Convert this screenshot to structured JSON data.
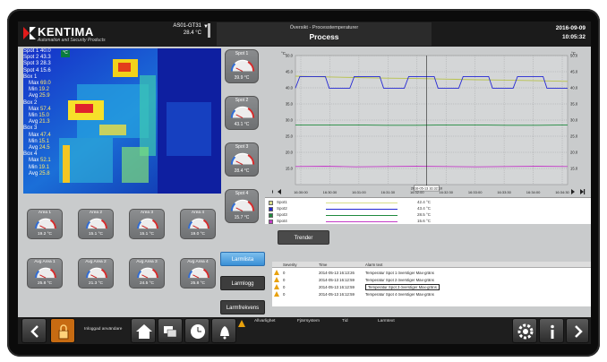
{
  "header": {
    "brand": "KENTIMA",
    "tagline": "Automation and Security Products",
    "sensor_id": "AS01-GT31",
    "sensor_value": "28.4 °C",
    "subtitle": "Översikt - Processtemperaturer",
    "title": "Process",
    "date": "2016-09-09",
    "time": "10:05:32"
  },
  "thermal": {
    "badge": "°C",
    "stats": [
      {
        "label": "Spot 1",
        "value": "40.0"
      },
      {
        "label": "Spot 2",
        "value": "43.3"
      },
      {
        "label": "Spot 3",
        "value": "28.3"
      },
      {
        "label": "Spot 4",
        "value": "15.6"
      },
      {
        "label": "Box 1",
        "value": ""
      },
      {
        "label": "Max",
        "value": "69.0"
      },
      {
        "label": "Min",
        "value": "19.2"
      },
      {
        "label": "Avg",
        "value": "25.9"
      },
      {
        "label": "Box 2",
        "value": ""
      },
      {
        "label": "Max",
        "value": "57.4"
      },
      {
        "label": "Min",
        "value": "15.0"
      },
      {
        "label": "Avg",
        "value": "21.3"
      },
      {
        "label": "Box 3",
        "value": ""
      },
      {
        "label": "Max",
        "value": "47.4"
      },
      {
        "label": "Min",
        "value": "15.1"
      },
      {
        "label": "Avg",
        "value": "24.5"
      },
      {
        "label": "Box 4",
        "value": ""
      },
      {
        "label": "Max",
        "value": "52.1"
      },
      {
        "label": "Min",
        "value": "19.1"
      },
      {
        "label": "Avg",
        "value": "25.8"
      }
    ]
  },
  "spots": [
    {
      "label": "Spot 1",
      "value": "39.9 °C"
    },
    {
      "label": "Spot 2",
      "value": "43.1 °C"
    },
    {
      "label": "Spot 3",
      "value": "28.4 °C"
    },
    {
      "label": "Spot 4",
      "value": "15.7 °C"
    }
  ],
  "area_gauges": [
    {
      "label": "Area 1",
      "value": "19.2 °C"
    },
    {
      "label": "Area 2",
      "value": "15.1 °C"
    },
    {
      "label": "Area 3",
      "value": "15.1 °C"
    },
    {
      "label": "Area 4",
      "value": "19.0 °C"
    }
  ],
  "avg_gauges": [
    {
      "label": "Avg Area 1",
      "value": "25.8 °C"
    },
    {
      "label": "Avg Area 2",
      "value": "21.3 °C"
    },
    {
      "label": "Avg Area 3",
      "value": "24.5 °C"
    },
    {
      "label": "Avg Area 4",
      "value": "25.8 °C"
    }
  ],
  "chart_data": {
    "type": "line",
    "ylabel": "°C",
    "ylim": [
      10,
      50
    ],
    "yticks": [
      "50.0",
      "45.0",
      "40.0",
      "35.0",
      "30.0",
      "25.0",
      "20.0",
      "15.0"
    ],
    "xticks": [
      "16:30:00",
      "16:30:30",
      "16:31:00",
      "16:31:30",
      "16:32:00",
      "16:32:30",
      "16:33:00",
      "16:33:30",
      "16:34:00",
      "16:34:30"
    ],
    "cursor_label": "2016-05-13 16:32:10",
    "cursor_x_index": 4.33,
    "grid": true,
    "series": [
      {
        "name": "Spot1",
        "color": "#b8c24a",
        "values": [
          43.6,
          43.4,
          43.2,
          43.0,
          42.9,
          42.7,
          42.5,
          42.4,
          42.2,
          42.0
        ]
      },
      {
        "name": "Spot2",
        "color": "#2326d4",
        "values": [
          43.5,
          39.9,
          43.4,
          39.9,
          43.3,
          39.9,
          43.4,
          39.9,
          43.2,
          40.1
        ]
      },
      {
        "name": "Spot3",
        "color": "#1f8a3e",
        "values": [
          28.5,
          28.5,
          28.5,
          28.4,
          28.4,
          28.5,
          28.5,
          28.4,
          28.4,
          28.5
        ]
      },
      {
        "name": "Spot4",
        "color": "#c43cc8",
        "values": [
          15.6,
          15.7,
          15.5,
          15.6,
          15.7,
          15.6,
          15.5,
          15.6,
          15.7,
          15.6
        ]
      }
    ]
  },
  "legend": [
    {
      "name": "Spot1",
      "value": "42.4 °C",
      "color": "#d8de8a"
    },
    {
      "name": "Spot2",
      "value": "43.4 °C",
      "color": "#2326d4"
    },
    {
      "name": "Spot3",
      "value": "28.5 °C",
      "color": "#1f8a3e"
    },
    {
      "name": "Spot4",
      "value": "15.6 °C",
      "color": "#c43cc8"
    }
  ],
  "buttons": {
    "trender": "Trender",
    "larmlista": "Larmlista",
    "larmlogg": "Larmlogg",
    "larmfrekvens": "Larmfrekvens"
  },
  "alarms": {
    "columns": [
      "Severity",
      "Time",
      "Alarm text"
    ],
    "rows": [
      {
        "severity": "0",
        "time": "2014-05-13 16:13:26",
        "text": "Temperatur Spot 1 överstiger Max-gräns"
      },
      {
        "severity": "0",
        "time": "2014-05-13 16:12:59",
        "text": "Temperatur Spot 2 överstiger Max-gräns"
      },
      {
        "severity": "0",
        "time": "2014-05-13 16:12:59",
        "text": "Temperatur Spot 3 överstiger Max-gräns"
      },
      {
        "severity": "0",
        "time": "2014-05-13 16:12:59",
        "text": "Temperatur Spot 4 överstiger Max-gräns"
      }
    ]
  },
  "footer": {
    "login": "Inloggad användare",
    "col_severity": "Allvarlighet",
    "col_remote": "Fjärrsystem",
    "col_time": "Tid",
    "col_alarmtext": "Larmtext"
  }
}
